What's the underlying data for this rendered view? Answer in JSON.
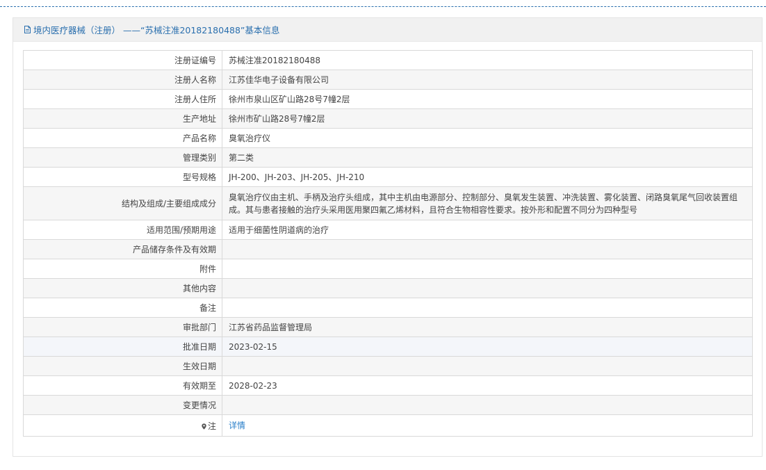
{
  "header": {
    "icon": "document-icon",
    "title": "境内医疗器械（注册） ——“苏械注准20182180488”基本信息"
  },
  "rows": [
    {
      "label": "注册证编号",
      "value": "苏械注准20182180488"
    },
    {
      "label": "注册人名称",
      "value": "江苏佳华电子设备有限公司"
    },
    {
      "label": "注册人住所",
      "value": "徐州市泉山区矿山路28号7幢2层"
    },
    {
      "label": "生产地址",
      "value": "徐州市矿山路28号7幢2层"
    },
    {
      "label": "产品名称",
      "value": "臭氧治疗仪"
    },
    {
      "label": "管理类别",
      "value": "第二类"
    },
    {
      "label": "型号规格",
      "value": "JH-200、JH-203、JH-205、JH-210"
    },
    {
      "label": "结构及组成/主要组成成分",
      "value": "臭氧治疗仪由主机、手柄及治疗头组成，其中主机由电源部分、控制部分、臭氧发生装置、冲洗装置、雾化装置、闭路臭氧尾气回收装置组成。其与患者接触的治疗头采用医用聚四氟乙烯材料，且符合生物相容性要求。按外形和配置不同分为四种型号"
    },
    {
      "label": "适用范围/预期用途",
      "value": "适用于细菌性阴道病的治疗"
    },
    {
      "label": "产品储存条件及有效期",
      "value": ""
    },
    {
      "label": "附件",
      "value": ""
    },
    {
      "label": "其他内容",
      "value": ""
    },
    {
      "label": "备注",
      "value": ""
    },
    {
      "label": "审批部门",
      "value": "江苏省药品监督管理局"
    },
    {
      "label": "批准日期",
      "value": "2023-02-15"
    },
    {
      "label": "生效日期",
      "value": ""
    },
    {
      "label": "有效期至",
      "value": "2028-02-23"
    },
    {
      "label": "变更情况",
      "value": ""
    },
    {
      "label": "注",
      "value": "详情",
      "icon": "location-pin-icon"
    }
  ]
}
